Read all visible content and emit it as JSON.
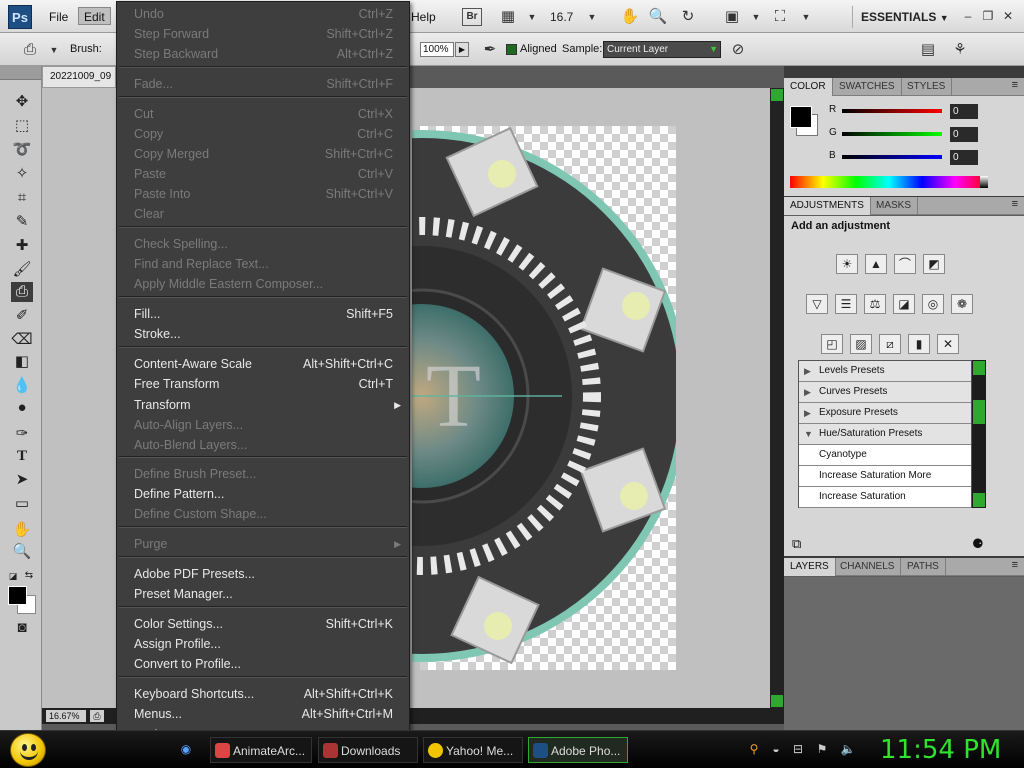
{
  "menubar": {
    "logo": "Ps",
    "file": "File",
    "edit": "Edit",
    "help": "Help",
    "bridge": "Br",
    "zoom": "16.7",
    "workspace": "ESSENTIALS"
  },
  "options": {
    "brush_label": "Brush:",
    "opacity": "100%",
    "aligned": "Aligned",
    "sample_label": "Sample:",
    "sample_value": "Current Layer"
  },
  "document": {
    "tab_title": "20221009_09",
    "status_zoom": "16.67%"
  },
  "edit_menu": {
    "items": [
      {
        "label": "Undo",
        "shortcut": "Ctrl+Z",
        "enabled": false
      },
      {
        "label": "Step Forward",
        "shortcut": "Shift+Ctrl+Z",
        "enabled": false
      },
      {
        "label": "Step Backward",
        "shortcut": "Alt+Ctrl+Z",
        "enabled": false
      },
      {
        "label": "Fade...",
        "shortcut": "Shift+Ctrl+F",
        "enabled": false
      },
      {
        "label": "Cut",
        "shortcut": "Ctrl+X",
        "enabled": false
      },
      {
        "label": "Copy",
        "shortcut": "Ctrl+C",
        "enabled": false
      },
      {
        "label": "Copy Merged",
        "shortcut": "Shift+Ctrl+C",
        "enabled": false
      },
      {
        "label": "Paste",
        "shortcut": "Ctrl+V",
        "enabled": false
      },
      {
        "label": "Paste Into",
        "shortcut": "Shift+Ctrl+V",
        "enabled": false
      },
      {
        "label": "Clear",
        "shortcut": "",
        "enabled": false
      },
      {
        "label": "Check Spelling...",
        "shortcut": "",
        "enabled": false
      },
      {
        "label": "Find and Replace Text...",
        "shortcut": "",
        "enabled": false
      },
      {
        "label": "Apply Middle Eastern Composer...",
        "shortcut": "",
        "enabled": false
      },
      {
        "label": "Fill...",
        "shortcut": "Shift+F5",
        "enabled": true
      },
      {
        "label": "Stroke...",
        "shortcut": "",
        "enabled": true
      },
      {
        "label": "Content-Aware Scale",
        "shortcut": "Alt+Shift+Ctrl+C",
        "enabled": true
      },
      {
        "label": "Free Transform",
        "shortcut": "Ctrl+T",
        "enabled": true
      },
      {
        "label": "Transform",
        "shortcut": "",
        "enabled": true
      },
      {
        "label": "Auto-Align Layers...",
        "shortcut": "",
        "enabled": false
      },
      {
        "label": "Auto-Blend Layers...",
        "shortcut": "",
        "enabled": false
      },
      {
        "label": "Define Brush Preset...",
        "shortcut": "",
        "enabled": false
      },
      {
        "label": "Define Pattern...",
        "shortcut": "",
        "enabled": true
      },
      {
        "label": "Define Custom Shape...",
        "shortcut": "",
        "enabled": false
      },
      {
        "label": "Purge",
        "shortcut": "",
        "enabled": false
      },
      {
        "label": "Adobe PDF Presets...",
        "shortcut": "",
        "enabled": true
      },
      {
        "label": "Preset Manager...",
        "shortcut": "",
        "enabled": true
      },
      {
        "label": "Color Settings...",
        "shortcut": "Shift+Ctrl+K",
        "enabled": true
      },
      {
        "label": "Assign Profile...",
        "shortcut": "",
        "enabled": true
      },
      {
        "label": "Convert to Profile...",
        "shortcut": "",
        "enabled": true
      },
      {
        "label": "Keyboard Shortcuts...",
        "shortcut": "Alt+Shift+Ctrl+K",
        "enabled": true
      },
      {
        "label": "Menus...",
        "shortcut": "Alt+Shift+Ctrl+M",
        "enabled": true
      },
      {
        "label": "Preferences",
        "shortcut": "",
        "enabled": true
      }
    ]
  },
  "color_panel": {
    "tabs": [
      "COLOR",
      "SWATCHES",
      "STYLES"
    ],
    "r_label": "R",
    "g_label": "G",
    "b_label": "B",
    "r_value": "0",
    "g_value": "0",
    "b_value": "0"
  },
  "adjustments_panel": {
    "tabs": [
      "ADJUSTMENTS",
      "MASKS"
    ],
    "title": "Add an adjustment",
    "presets": [
      {
        "label": "Levels Presets"
      },
      {
        "label": "Curves Presets"
      },
      {
        "label": "Exposure Presets"
      },
      {
        "label": "Hue/Saturation Presets"
      },
      {
        "label": "Cyanotype"
      },
      {
        "label": "Increase Saturation More"
      },
      {
        "label": "Increase Saturation"
      }
    ]
  },
  "layers_panel": {
    "tabs": [
      "LAYERS",
      "CHANNELS",
      "PATHS"
    ]
  },
  "taskbar": {
    "tasks": [
      {
        "label": "AnimateArc..."
      },
      {
        "label": "Downloads"
      },
      {
        "label": "Yahoo! Me..."
      },
      {
        "label": "Adobe Pho..."
      }
    ],
    "clock": "11:54 PM"
  },
  "colors": {
    "accent_green": "#2fe32f",
    "menu_bg": "#3e3e3e"
  }
}
